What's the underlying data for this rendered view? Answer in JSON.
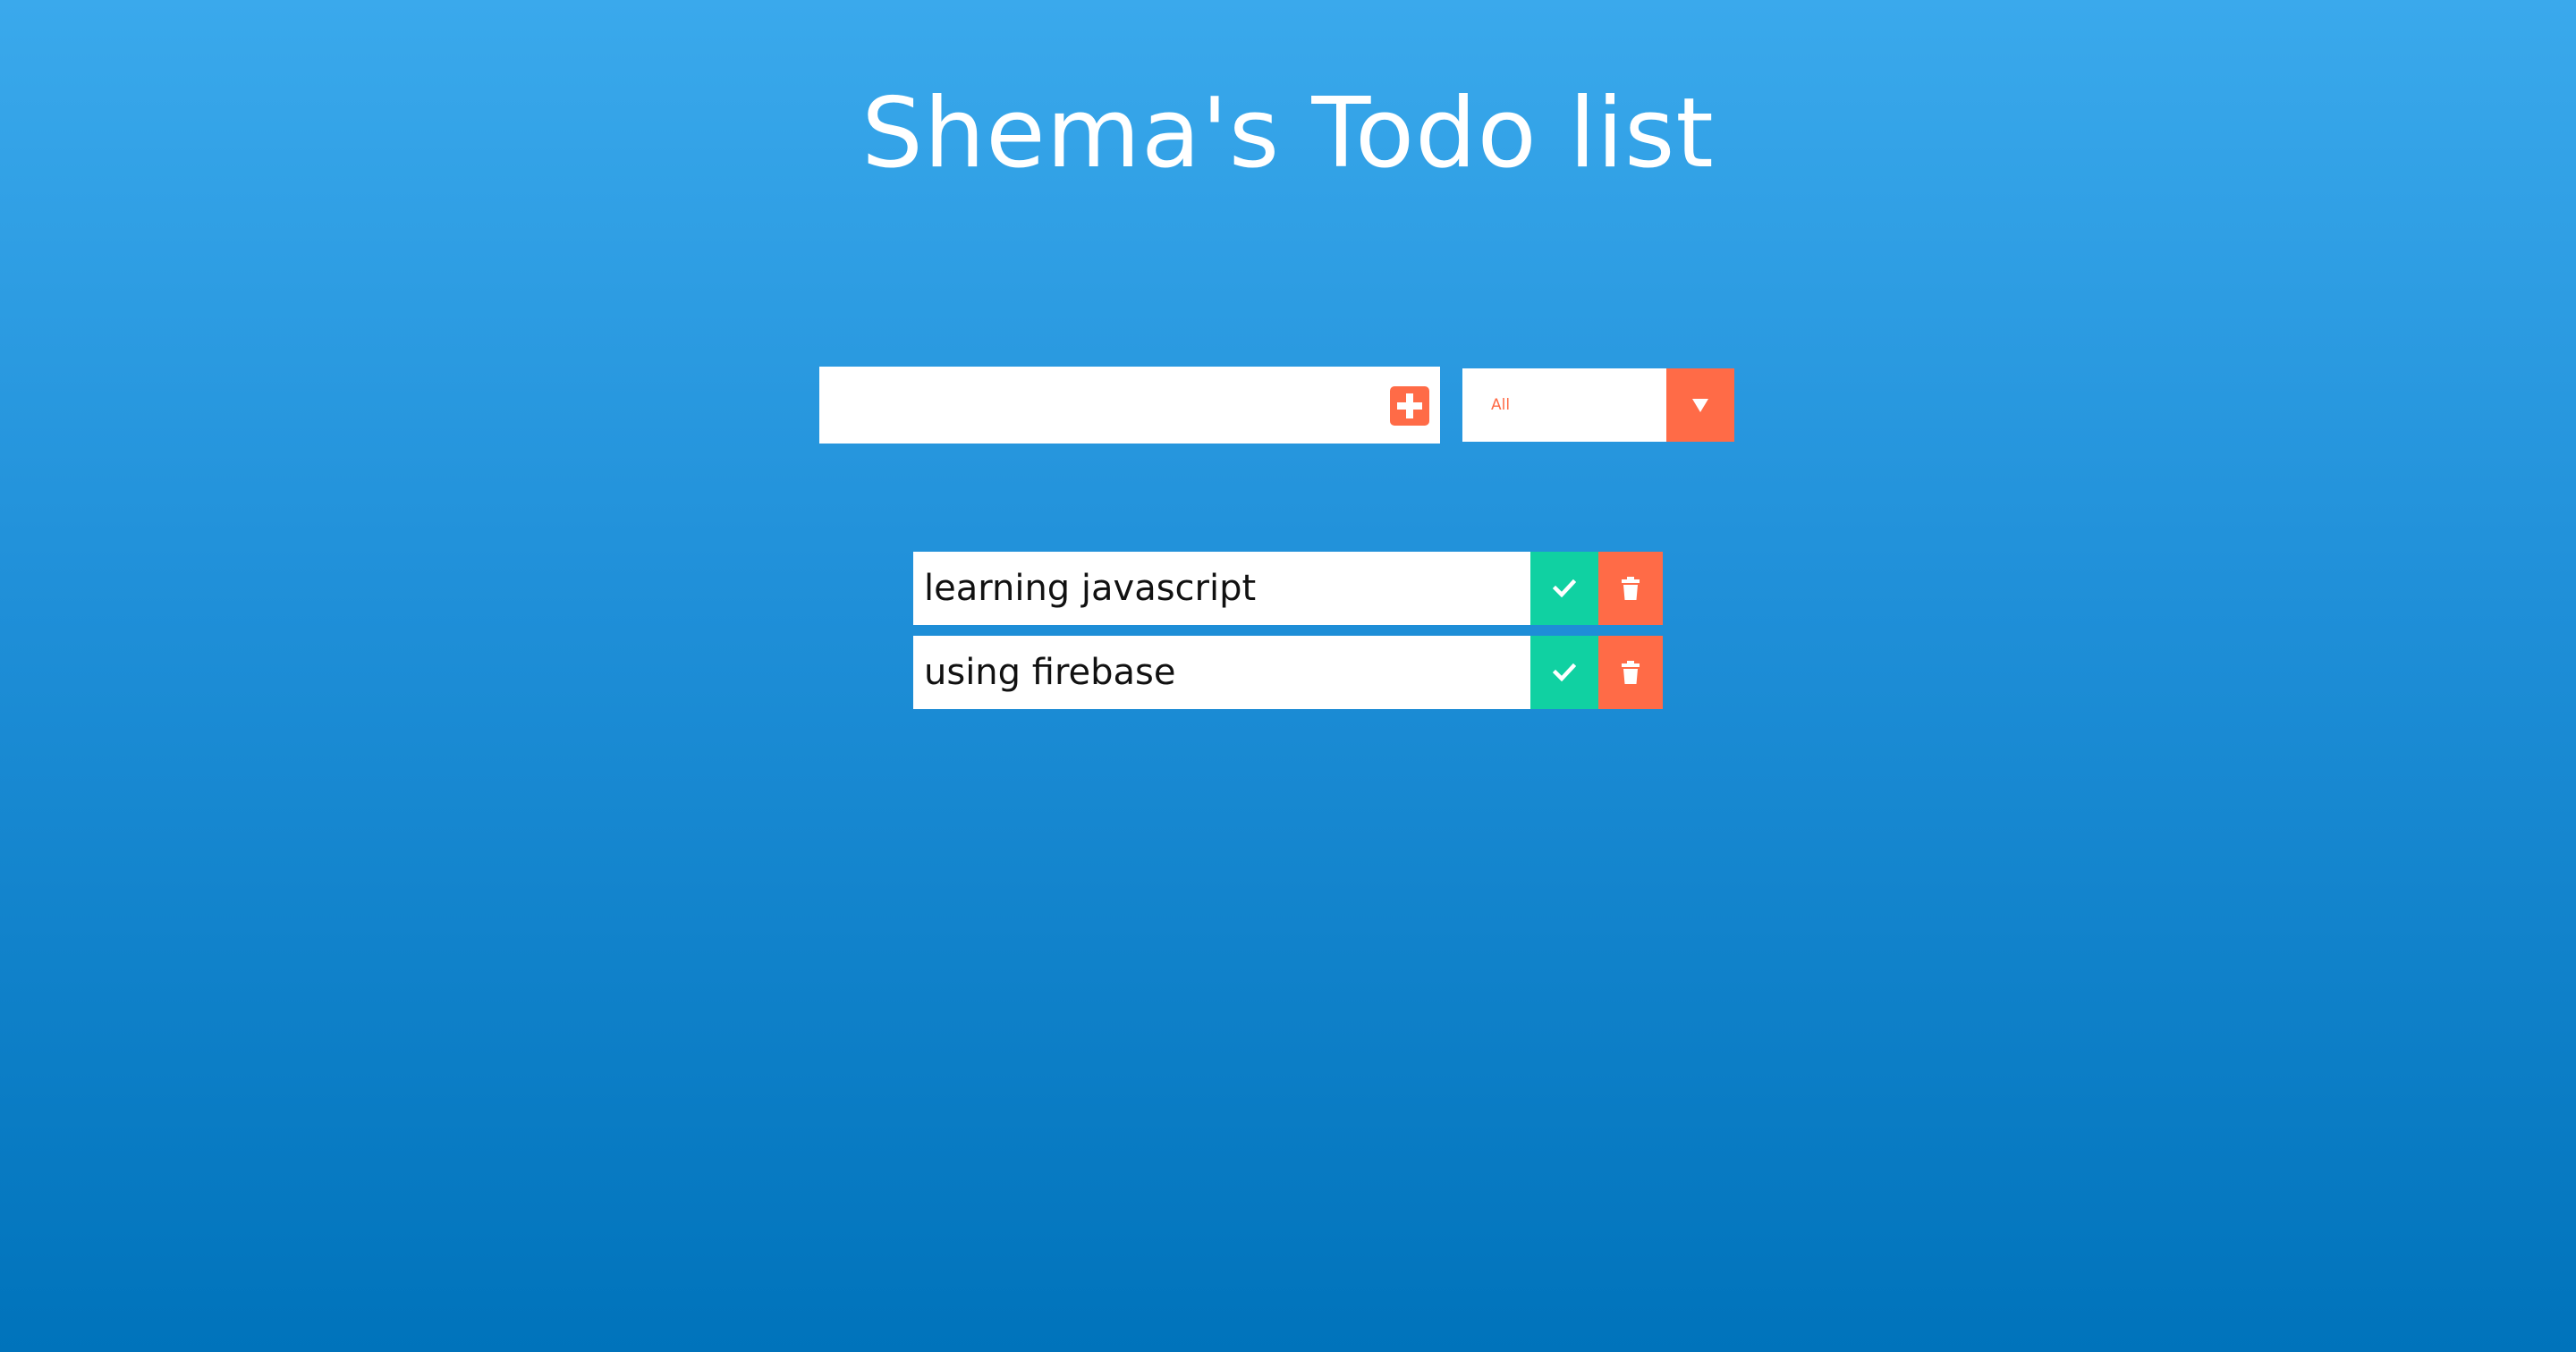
{
  "header": {
    "title": "Shema's Todo list"
  },
  "form": {
    "input_value": "",
    "input_placeholder": "",
    "add_icon": "plus-square-icon",
    "filter_selected": "All",
    "filter_icon": "caret-down-icon"
  },
  "todos": [
    {
      "text": "learning javascript",
      "complete_icon": "check-icon",
      "delete_icon": "trash-icon"
    },
    {
      "text": "using firebase",
      "complete_icon": "check-icon",
      "delete_icon": "trash-icon"
    }
  ],
  "colors": {
    "background_top": "#3aa9ec",
    "background_bottom": "#0073bb",
    "accent": "#ff6b47",
    "complete": "#10d1a2"
  }
}
